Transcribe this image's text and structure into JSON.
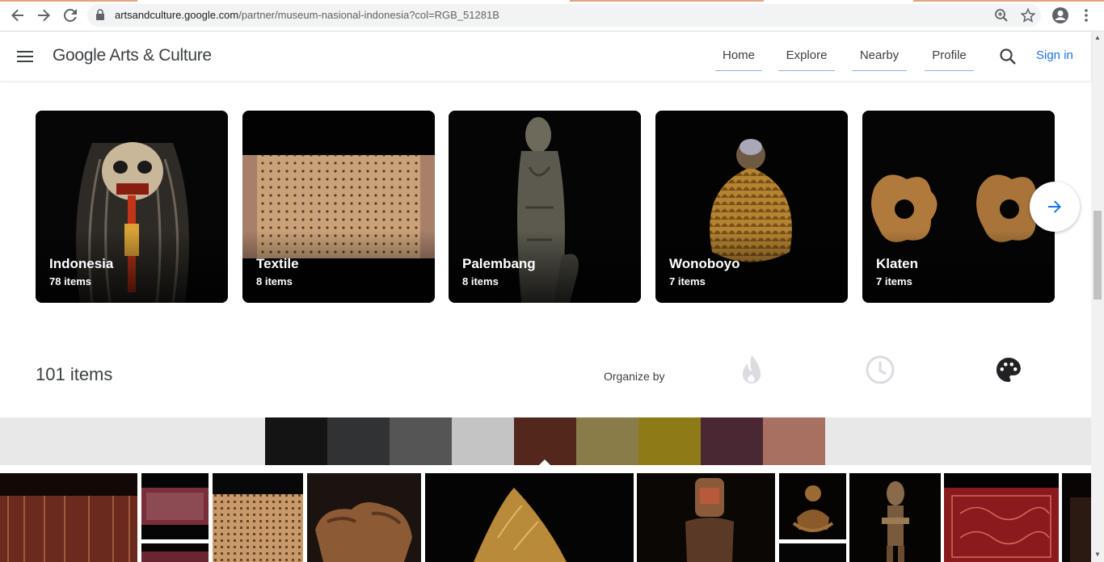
{
  "browser": {
    "url_host": "artsandculture.google.com",
    "url_path": "/partner/museum-nasional-indonesia?col=RGB_51281B"
  },
  "header": {
    "logo": "Google Arts & Culture",
    "nav": [
      "Home",
      "Explore",
      "Nearby",
      "Profile"
    ],
    "signin": "Sign in"
  },
  "topics": [
    {
      "title": "Indonesia",
      "count": "78 items"
    },
    {
      "title": "Textile",
      "count": "8 items"
    },
    {
      "title": "Palembang",
      "count": "8 items"
    },
    {
      "title": "Wonoboyo",
      "count": "7 items"
    },
    {
      "title": "Klaten",
      "count": "7 items"
    }
  ],
  "organize": {
    "total": "101 items",
    "label": "Organize by",
    "modes": [
      "popularity-flame-icon",
      "time-clock-icon",
      "color-palette-icon"
    ],
    "active_mode": "color-palette-icon"
  },
  "colors": {
    "swatches": [
      "#141414",
      "#303234",
      "#555555",
      "#c4c4c4",
      "#51281b",
      "#8a7c48",
      "#8f7a18",
      "#4a2833",
      "#a87060"
    ],
    "selected": "#51281b"
  }
}
